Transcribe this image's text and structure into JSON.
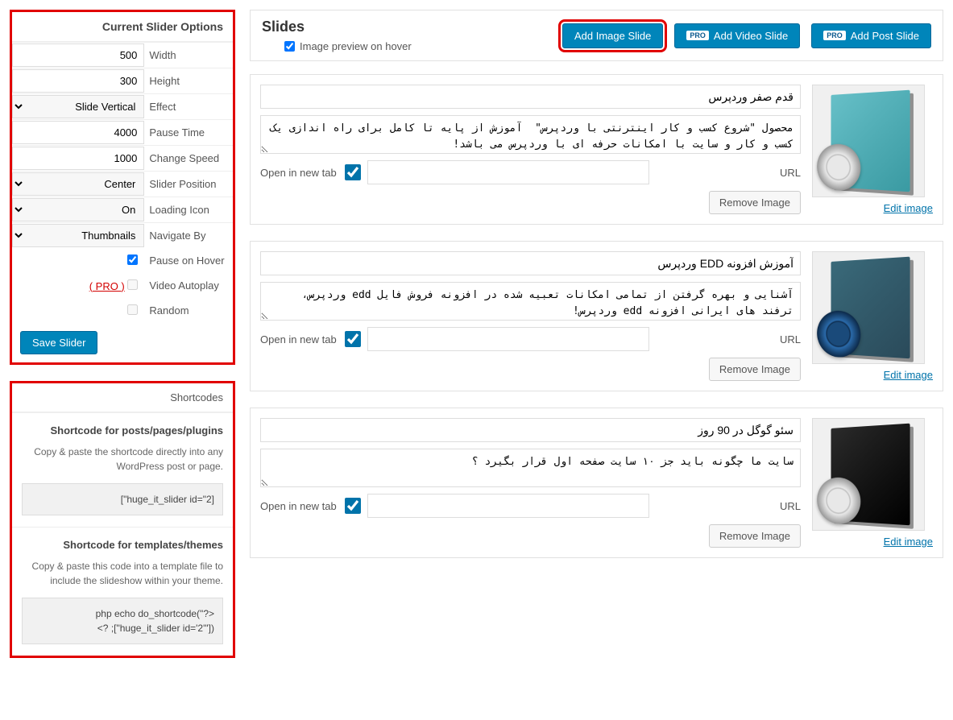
{
  "options": {
    "panel_title": "Current Slider Options",
    "width_label": "Width",
    "width_value": "500",
    "height_label": "Height",
    "height_value": "300",
    "effect_label": "Effect",
    "effect_value": "Slide Vertical",
    "pause_label": "Pause Time",
    "pause_value": "4000",
    "speed_label": "Change Speed",
    "speed_value": "1000",
    "position_label": "Slider Position",
    "position_value": "Center",
    "loading_label": "Loading Icon",
    "loading_value": "On",
    "navigate_label": "Navigate By",
    "navigate_value": "Thumbnails",
    "pause_hover_label": "Pause on Hover",
    "video_autoplay_label": "Video Autoplay",
    "random_label": "Random",
    "pro_tag": "( PRO )",
    "save_button": "Save Slider"
  },
  "shortcodes": {
    "panel_title": "Shortcodes",
    "posts_heading": "Shortcode for posts/pages/plugins",
    "posts_desc": "Copy & paste the shortcode directly into any WordPress post or page.",
    "posts_code": "[\"huge_it_slider id=\"2]",
    "templates_heading": "Shortcode for templates/themes",
    "templates_desc": "Copy & paste this code into a template file to include the slideshow within your theme.",
    "templates_code": "php echo do_shortcode(\"?>\n<? ;[\"huge_it_slider id='2'\"])"
  },
  "header": {
    "title": "Slides",
    "preview_label": "Image preview on hover",
    "add_image": "Add Image Slide",
    "add_video": "Add Video Slide",
    "add_post": "Add Post Slide",
    "pro_badge": "PRO"
  },
  "slides": [
    {
      "title": "قدم صفر وردپرس",
      "desc": "محصول \"شروع کسب و کار اینترنتی با وردپرس\"  آموزش از پایه تا کامل برای راه اندازی یک کسب و کار و سایت با امکانات حرفه ای با وردپرس می باشد!",
      "url_label": "URL",
      "newtab_label": "Open in new tab",
      "remove_label": "Remove Image",
      "edit_label": "Edit image"
    },
    {
      "title": "آموزش افزونه EDD وردپرس",
      "desc": "آشنایی و بهره گرفتن از تمامی امکانات تعبیه شده در افزونه فروش فایل edd وردپرس، ترفند های ایرانی افزونه edd وردپرس!",
      "url_label": "URL",
      "newtab_label": "Open in new tab",
      "remove_label": "Remove Image",
      "edit_label": "Edit image"
    },
    {
      "title": "سئو گوگل در 90 روز",
      "desc": "سایت ما چگونه باید جز ۱۰ سایت صفحه اول قرار بگیرد ؟",
      "url_label": "URL",
      "newtab_label": "Open in new tab",
      "remove_label": "Remove Image",
      "edit_label": "Edit image"
    }
  ]
}
